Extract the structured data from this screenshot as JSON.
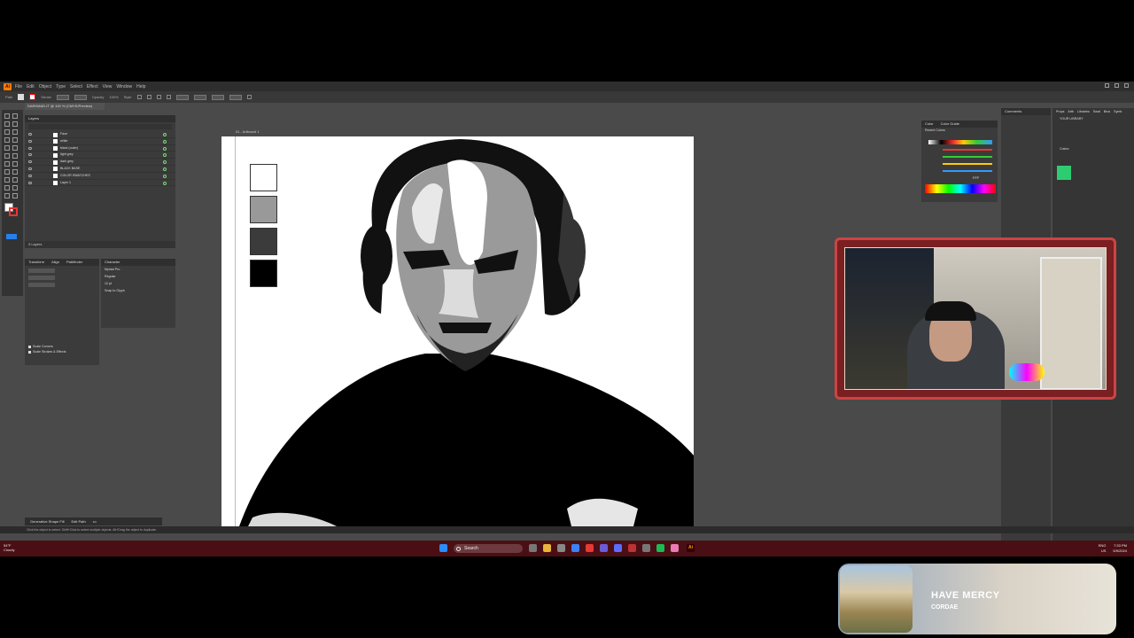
{
  "app": {
    "logo": "Ai",
    "menu": [
      "File",
      "Edit",
      "Object",
      "Type",
      "Select",
      "Effect",
      "View",
      "Window",
      "Help"
    ],
    "control_bar": {
      "mode": "Path",
      "stroke_label": "Stroke",
      "opacity_label": "Opacity",
      "opacity_value": "100%",
      "style_label": "Style"
    },
    "doc_tab": "DARKMAD-IT @ 100 % (CMYK/Preview)",
    "artboard_label": "01 - Artboard 1"
  },
  "layers_panel": {
    "tabs": [
      "Layers"
    ],
    "rows": [
      "Face",
      "white",
      "black (outer)",
      "light grey",
      "dark grey",
      "BLACK BASE",
      "COLOR SWATCHES",
      "Layer 1"
    ],
    "footer": "3 Layers"
  },
  "transform_panel": {
    "tabs": [
      "Transform",
      "Align",
      "Pathfinder"
    ],
    "checkboxes": [
      "Scale Corners",
      "Scale Strokes & Effects"
    ]
  },
  "character_panel": {
    "tab": "Character",
    "font": "Myriad Pro",
    "style": "Regular",
    "size": "12 pt",
    "snap_label": "Snap to Glyph"
  },
  "artboard": {
    "swatches": [
      "#ffffff",
      "#999999",
      "#3b3b3b",
      "#000000"
    ]
  },
  "color_panel": {
    "tabs": [
      "Color",
      "Color Guide"
    ],
    "label": "Recent Colors",
    "hex_value": "FFF"
  },
  "right_panels": {
    "comments": "Comments",
    "tabs": [
      "Props",
      "Artb",
      "Libraries",
      "Swat",
      "Brus",
      "Symb"
    ],
    "library_name": "YOUR LIBRARY",
    "colors_label": "Colors",
    "library_color": "#2ecc71"
  },
  "bottom_bar": {
    "generative": "Generative Shape Fill",
    "edit_path": "Edit Path"
  },
  "status_text": "Click the object to select. Shift+Click to select multiple objects. Alt+Drag the object to duplicate.",
  "taskbar": {
    "weather_temp": "54°F",
    "weather_desc": "Cloudy",
    "search_placeholder": "Search",
    "lang": "ENG",
    "region": "US",
    "time": "7:33 PM",
    "date": "5/9/2024"
  },
  "now_playing": {
    "title": "HAVE MERCY",
    "artist": "CORDAE"
  }
}
